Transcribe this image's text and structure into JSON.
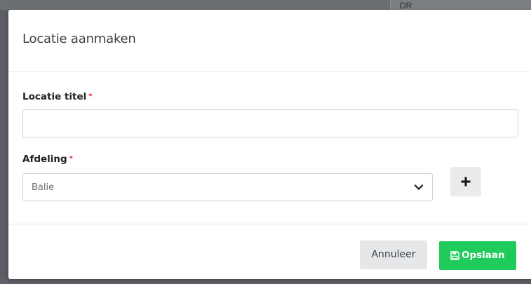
{
  "background": {
    "partial_text": "DR"
  },
  "modal": {
    "title": "Locatie aanmaken",
    "fields": {
      "title": {
        "label": "Locatie titel",
        "required_marker": "*",
        "value": "",
        "placeholder": ""
      },
      "department": {
        "label": "Afdeling",
        "required_marker": "*",
        "selected": "Balie"
      }
    },
    "add_button": {
      "icon": "plus-icon"
    },
    "footer": {
      "cancel_label": "Annuleer",
      "save_label": "Opslaan",
      "save_icon": "floppy-disk-icon"
    }
  },
  "colors": {
    "primary_save": "#1fcb5a",
    "required": "#e2262b",
    "neutral_button": "#e5e7e9"
  }
}
